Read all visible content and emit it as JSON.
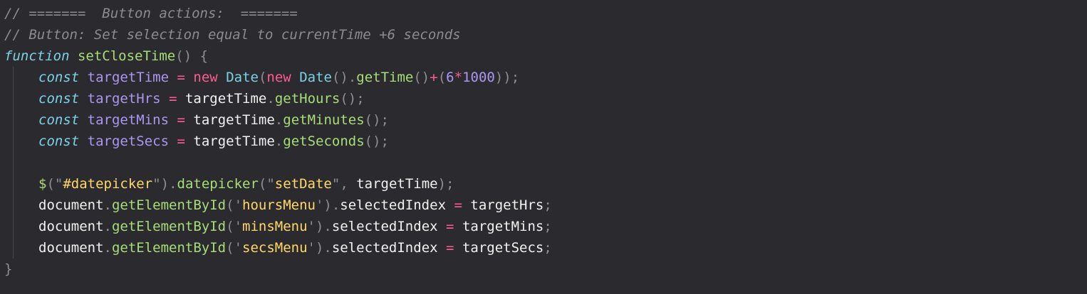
{
  "editor": {
    "colors": {
      "background": "#2b2a2f",
      "comment": "#8c8b90",
      "keyword": "#7ad3e6",
      "function": "#a6de77",
      "variable": "#ac97f0",
      "operator": "#ff5d8f",
      "punctuation": "#8f8e94",
      "string": "#ffd866",
      "text": "#f2f2f0"
    },
    "lines": [
      {
        "indent": false,
        "tokens": [
          {
            "t": "// =======  Button actions:  =======",
            "c": "comment"
          }
        ]
      },
      {
        "indent": false,
        "tokens": [
          {
            "t": "// Button: Set selection equal to currentTime +6 seconds",
            "c": "comment"
          }
        ]
      },
      {
        "indent": false,
        "tokens": [
          {
            "t": "function",
            "c": "kw-italic"
          },
          {
            "t": " ",
            "c": "plain"
          },
          {
            "t": "setCloseTime",
            "c": "fn"
          },
          {
            "t": "()",
            "c": "pn"
          },
          {
            "t": " {",
            "c": "pn"
          }
        ]
      },
      {
        "indent": true,
        "tokens": [
          {
            "t": "const",
            "c": "kw-italic"
          },
          {
            "t": " ",
            "c": "plain"
          },
          {
            "t": "targetTime",
            "c": "var"
          },
          {
            "t": " ",
            "c": "plain"
          },
          {
            "t": "=",
            "c": "op"
          },
          {
            "t": " ",
            "c": "plain"
          },
          {
            "t": "new",
            "c": "op"
          },
          {
            "t": " ",
            "c": "plain"
          },
          {
            "t": "Date",
            "c": "cls"
          },
          {
            "t": "(",
            "c": "pn"
          },
          {
            "t": "new",
            "c": "op"
          },
          {
            "t": " ",
            "c": "plain"
          },
          {
            "t": "Date",
            "c": "cls"
          },
          {
            "t": "().",
            "c": "pn"
          },
          {
            "t": "getTime",
            "c": "fn"
          },
          {
            "t": "()",
            "c": "pn"
          },
          {
            "t": "+",
            "c": "op"
          },
          {
            "t": "(",
            "c": "pn"
          },
          {
            "t": "6",
            "c": "num"
          },
          {
            "t": "*",
            "c": "op"
          },
          {
            "t": "1000",
            "c": "num"
          },
          {
            "t": "));",
            "c": "pn"
          }
        ]
      },
      {
        "indent": true,
        "tokens": [
          {
            "t": "const",
            "c": "kw-italic"
          },
          {
            "t": " ",
            "c": "plain"
          },
          {
            "t": "targetHrs",
            "c": "var"
          },
          {
            "t": " ",
            "c": "plain"
          },
          {
            "t": "=",
            "c": "op"
          },
          {
            "t": " ",
            "c": "plain"
          },
          {
            "t": "targetTime",
            "c": "plain"
          },
          {
            "t": ".",
            "c": "pn"
          },
          {
            "t": "getHours",
            "c": "fn"
          },
          {
            "t": "();",
            "c": "pn"
          }
        ]
      },
      {
        "indent": true,
        "tokens": [
          {
            "t": "const",
            "c": "kw-italic"
          },
          {
            "t": " ",
            "c": "plain"
          },
          {
            "t": "targetMins",
            "c": "var"
          },
          {
            "t": " ",
            "c": "plain"
          },
          {
            "t": "=",
            "c": "op"
          },
          {
            "t": " ",
            "c": "plain"
          },
          {
            "t": "targetTime",
            "c": "plain"
          },
          {
            "t": ".",
            "c": "pn"
          },
          {
            "t": "getMinutes",
            "c": "fn"
          },
          {
            "t": "();",
            "c": "pn"
          }
        ]
      },
      {
        "indent": true,
        "tokens": [
          {
            "t": "const",
            "c": "kw-italic"
          },
          {
            "t": " ",
            "c": "plain"
          },
          {
            "t": "targetSecs",
            "c": "var"
          },
          {
            "t": " ",
            "c": "plain"
          },
          {
            "t": "=",
            "c": "op"
          },
          {
            "t": " ",
            "c": "plain"
          },
          {
            "t": "targetTime",
            "c": "plain"
          },
          {
            "t": ".",
            "c": "pn"
          },
          {
            "t": "getSeconds",
            "c": "fn"
          },
          {
            "t": "();",
            "c": "pn"
          }
        ]
      },
      {
        "indent": true,
        "tokens": []
      },
      {
        "indent": true,
        "tokens": [
          {
            "t": "$",
            "c": "fn"
          },
          {
            "t": "(\"",
            "c": "pn"
          },
          {
            "t": "#datepicker",
            "c": "str"
          },
          {
            "t": "\").",
            "c": "pn"
          },
          {
            "t": "datepicker",
            "c": "fn"
          },
          {
            "t": "(\"",
            "c": "pn"
          },
          {
            "t": "setDate",
            "c": "str"
          },
          {
            "t": "\",",
            "c": "pn"
          },
          {
            "t": " ",
            "c": "plain"
          },
          {
            "t": "targetTime",
            "c": "plain"
          },
          {
            "t": ");",
            "c": "pn"
          }
        ]
      },
      {
        "indent": true,
        "tokens": [
          {
            "t": "document",
            "c": "plain"
          },
          {
            "t": ".",
            "c": "pn"
          },
          {
            "t": "getElementById",
            "c": "fn"
          },
          {
            "t": "('",
            "c": "pn"
          },
          {
            "t": "hoursMenu",
            "c": "str"
          },
          {
            "t": "').",
            "c": "pn"
          },
          {
            "t": "selectedIndex",
            "c": "plain"
          },
          {
            "t": " ",
            "c": "plain"
          },
          {
            "t": "=",
            "c": "op"
          },
          {
            "t": " ",
            "c": "plain"
          },
          {
            "t": "targetHrs",
            "c": "plain"
          },
          {
            "t": ";",
            "c": "pn"
          }
        ]
      },
      {
        "indent": true,
        "tokens": [
          {
            "t": "document",
            "c": "plain"
          },
          {
            "t": ".",
            "c": "pn"
          },
          {
            "t": "getElementById",
            "c": "fn"
          },
          {
            "t": "('",
            "c": "pn"
          },
          {
            "t": "minsMenu",
            "c": "str"
          },
          {
            "t": "').",
            "c": "pn"
          },
          {
            "t": "selectedIndex",
            "c": "plain"
          },
          {
            "t": " ",
            "c": "plain"
          },
          {
            "t": "=",
            "c": "op"
          },
          {
            "t": " ",
            "c": "plain"
          },
          {
            "t": "targetMins",
            "c": "plain"
          },
          {
            "t": ";",
            "c": "pn"
          }
        ]
      },
      {
        "indent": true,
        "tokens": [
          {
            "t": "document",
            "c": "plain"
          },
          {
            "t": ".",
            "c": "pn"
          },
          {
            "t": "getElementById",
            "c": "fn"
          },
          {
            "t": "('",
            "c": "pn"
          },
          {
            "t": "secsMenu",
            "c": "str"
          },
          {
            "t": "').",
            "c": "pn"
          },
          {
            "t": "selectedIndex",
            "c": "plain"
          },
          {
            "t": " ",
            "c": "plain"
          },
          {
            "t": "=",
            "c": "op"
          },
          {
            "t": " ",
            "c": "plain"
          },
          {
            "t": "targetSecs",
            "c": "plain"
          },
          {
            "t": ";",
            "c": "pn"
          }
        ]
      },
      {
        "indent": false,
        "tokens": [
          {
            "t": "}",
            "c": "pn"
          }
        ]
      }
    ]
  }
}
